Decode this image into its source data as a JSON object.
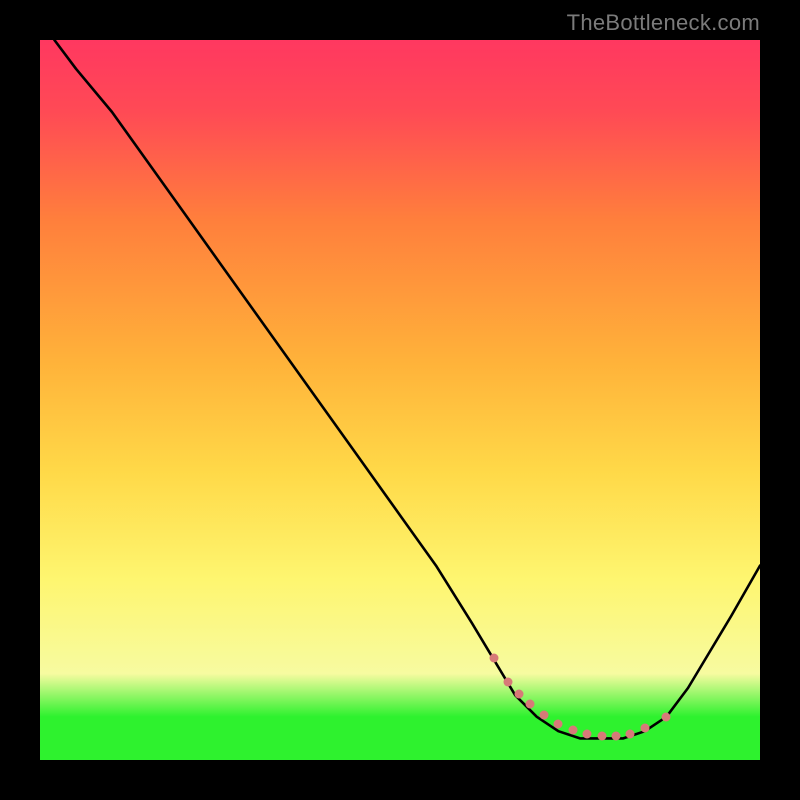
{
  "watermark": "TheBottleneck.com",
  "chart_data": {
    "type": "line",
    "title": "",
    "xlabel": "",
    "ylabel": "",
    "xlim": [
      0,
      100
    ],
    "ylim": [
      0,
      100
    ],
    "series": [
      {
        "name": "curve",
        "x": [
          2,
          5,
          10,
          15,
          20,
          25,
          30,
          35,
          40,
          45,
          50,
          55,
          60,
          63,
          66,
          69,
          72,
          75,
          78,
          81,
          84,
          87,
          90,
          93,
          96,
          100
        ],
        "y": [
          100,
          96,
          90,
          83,
          76,
          69,
          62,
          55,
          48,
          41,
          34,
          27,
          19,
          14,
          9,
          6,
          4,
          3,
          3,
          3,
          4,
          6,
          10,
          15,
          20,
          27
        ]
      }
    ],
    "markers": {
      "name": "dotted-segment",
      "x": [
        63,
        65,
        66.5,
        68,
        70,
        72,
        74,
        76,
        78,
        80,
        82,
        84,
        87
      ],
      "y": [
        14.2,
        10.8,
        9.2,
        7.8,
        6.3,
        5.0,
        4.2,
        3.6,
        3.3,
        3.3,
        3.6,
        4.4,
        6.0
      ]
    },
    "background_gradient": {
      "stops": [
        {
          "pos": 0,
          "color": "#2ef22e"
        },
        {
          "pos": 6,
          "color": "#2ef22e"
        },
        {
          "pos": 12,
          "color": "#f7fba0"
        },
        {
          "pos": 25,
          "color": "#fef670"
        },
        {
          "pos": 40,
          "color": "#ffd948"
        },
        {
          "pos": 55,
          "color": "#ffb33a"
        },
        {
          "pos": 75,
          "color": "#ff7f3c"
        },
        {
          "pos": 90,
          "color": "#ff4a55"
        },
        {
          "pos": 100,
          "color": "#ff3860"
        }
      ]
    }
  }
}
